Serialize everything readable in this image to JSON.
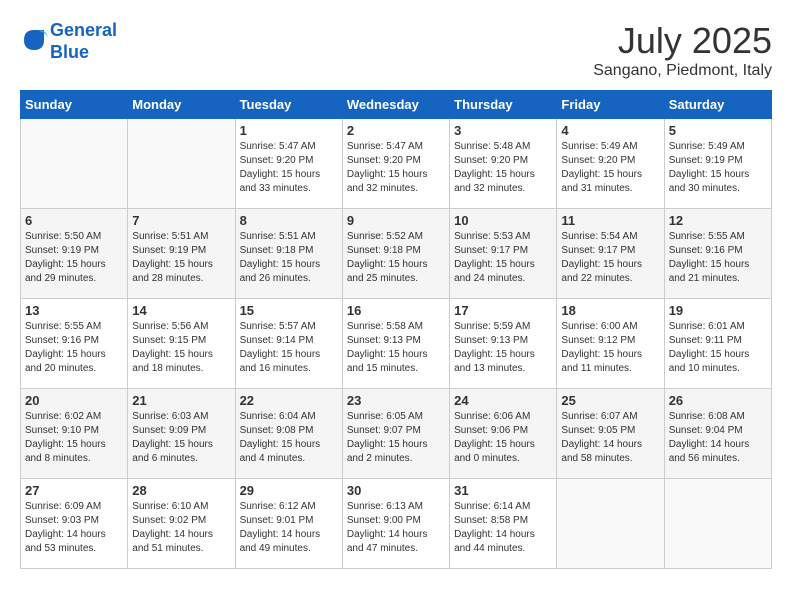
{
  "header": {
    "logo_line1": "General",
    "logo_line2": "Blue",
    "month": "July 2025",
    "location": "Sangano, Piedmont, Italy"
  },
  "weekdays": [
    "Sunday",
    "Monday",
    "Tuesday",
    "Wednesday",
    "Thursday",
    "Friday",
    "Saturday"
  ],
  "weeks": [
    [
      {
        "day": "",
        "empty": true
      },
      {
        "day": "",
        "empty": true
      },
      {
        "day": "1",
        "sunrise": "Sunrise: 5:47 AM",
        "sunset": "Sunset: 9:20 PM",
        "daylight": "Daylight: 15 hours and 33 minutes."
      },
      {
        "day": "2",
        "sunrise": "Sunrise: 5:47 AM",
        "sunset": "Sunset: 9:20 PM",
        "daylight": "Daylight: 15 hours and 32 minutes."
      },
      {
        "day": "3",
        "sunrise": "Sunrise: 5:48 AM",
        "sunset": "Sunset: 9:20 PM",
        "daylight": "Daylight: 15 hours and 32 minutes."
      },
      {
        "day": "4",
        "sunrise": "Sunrise: 5:49 AM",
        "sunset": "Sunset: 9:20 PM",
        "daylight": "Daylight: 15 hours and 31 minutes."
      },
      {
        "day": "5",
        "sunrise": "Sunrise: 5:49 AM",
        "sunset": "Sunset: 9:19 PM",
        "daylight": "Daylight: 15 hours and 30 minutes."
      }
    ],
    [
      {
        "day": "6",
        "sunrise": "Sunrise: 5:50 AM",
        "sunset": "Sunset: 9:19 PM",
        "daylight": "Daylight: 15 hours and 29 minutes."
      },
      {
        "day": "7",
        "sunrise": "Sunrise: 5:51 AM",
        "sunset": "Sunset: 9:19 PM",
        "daylight": "Daylight: 15 hours and 28 minutes."
      },
      {
        "day": "8",
        "sunrise": "Sunrise: 5:51 AM",
        "sunset": "Sunset: 9:18 PM",
        "daylight": "Daylight: 15 hours and 26 minutes."
      },
      {
        "day": "9",
        "sunrise": "Sunrise: 5:52 AM",
        "sunset": "Sunset: 9:18 PM",
        "daylight": "Daylight: 15 hours and 25 minutes."
      },
      {
        "day": "10",
        "sunrise": "Sunrise: 5:53 AM",
        "sunset": "Sunset: 9:17 PM",
        "daylight": "Daylight: 15 hours and 24 minutes."
      },
      {
        "day": "11",
        "sunrise": "Sunrise: 5:54 AM",
        "sunset": "Sunset: 9:17 PM",
        "daylight": "Daylight: 15 hours and 22 minutes."
      },
      {
        "day": "12",
        "sunrise": "Sunrise: 5:55 AM",
        "sunset": "Sunset: 9:16 PM",
        "daylight": "Daylight: 15 hours and 21 minutes."
      }
    ],
    [
      {
        "day": "13",
        "sunrise": "Sunrise: 5:55 AM",
        "sunset": "Sunset: 9:16 PM",
        "daylight": "Daylight: 15 hours and 20 minutes."
      },
      {
        "day": "14",
        "sunrise": "Sunrise: 5:56 AM",
        "sunset": "Sunset: 9:15 PM",
        "daylight": "Daylight: 15 hours and 18 minutes."
      },
      {
        "day": "15",
        "sunrise": "Sunrise: 5:57 AM",
        "sunset": "Sunset: 9:14 PM",
        "daylight": "Daylight: 15 hours and 16 minutes."
      },
      {
        "day": "16",
        "sunrise": "Sunrise: 5:58 AM",
        "sunset": "Sunset: 9:13 PM",
        "daylight": "Daylight: 15 hours and 15 minutes."
      },
      {
        "day": "17",
        "sunrise": "Sunrise: 5:59 AM",
        "sunset": "Sunset: 9:13 PM",
        "daylight": "Daylight: 15 hours and 13 minutes."
      },
      {
        "day": "18",
        "sunrise": "Sunrise: 6:00 AM",
        "sunset": "Sunset: 9:12 PM",
        "daylight": "Daylight: 15 hours and 11 minutes."
      },
      {
        "day": "19",
        "sunrise": "Sunrise: 6:01 AM",
        "sunset": "Sunset: 9:11 PM",
        "daylight": "Daylight: 15 hours and 10 minutes."
      }
    ],
    [
      {
        "day": "20",
        "sunrise": "Sunrise: 6:02 AM",
        "sunset": "Sunset: 9:10 PM",
        "daylight": "Daylight: 15 hours and 8 minutes."
      },
      {
        "day": "21",
        "sunrise": "Sunrise: 6:03 AM",
        "sunset": "Sunset: 9:09 PM",
        "daylight": "Daylight: 15 hours and 6 minutes."
      },
      {
        "day": "22",
        "sunrise": "Sunrise: 6:04 AM",
        "sunset": "Sunset: 9:08 PM",
        "daylight": "Daylight: 15 hours and 4 minutes."
      },
      {
        "day": "23",
        "sunrise": "Sunrise: 6:05 AM",
        "sunset": "Sunset: 9:07 PM",
        "daylight": "Daylight: 15 hours and 2 minutes."
      },
      {
        "day": "24",
        "sunrise": "Sunrise: 6:06 AM",
        "sunset": "Sunset: 9:06 PM",
        "daylight": "Daylight: 15 hours and 0 minutes."
      },
      {
        "day": "25",
        "sunrise": "Sunrise: 6:07 AM",
        "sunset": "Sunset: 9:05 PM",
        "daylight": "Daylight: 14 hours and 58 minutes."
      },
      {
        "day": "26",
        "sunrise": "Sunrise: 6:08 AM",
        "sunset": "Sunset: 9:04 PM",
        "daylight": "Daylight: 14 hours and 56 minutes."
      }
    ],
    [
      {
        "day": "27",
        "sunrise": "Sunrise: 6:09 AM",
        "sunset": "Sunset: 9:03 PM",
        "daylight": "Daylight: 14 hours and 53 minutes."
      },
      {
        "day": "28",
        "sunrise": "Sunrise: 6:10 AM",
        "sunset": "Sunset: 9:02 PM",
        "daylight": "Daylight: 14 hours and 51 minutes."
      },
      {
        "day": "29",
        "sunrise": "Sunrise: 6:12 AM",
        "sunset": "Sunset: 9:01 PM",
        "daylight": "Daylight: 14 hours and 49 minutes."
      },
      {
        "day": "30",
        "sunrise": "Sunrise: 6:13 AM",
        "sunset": "Sunset: 9:00 PM",
        "daylight": "Daylight: 14 hours and 47 minutes."
      },
      {
        "day": "31",
        "sunrise": "Sunrise: 6:14 AM",
        "sunset": "Sunset: 8:58 PM",
        "daylight": "Daylight: 14 hours and 44 minutes."
      },
      {
        "day": "",
        "empty": true
      },
      {
        "day": "",
        "empty": true
      }
    ]
  ]
}
